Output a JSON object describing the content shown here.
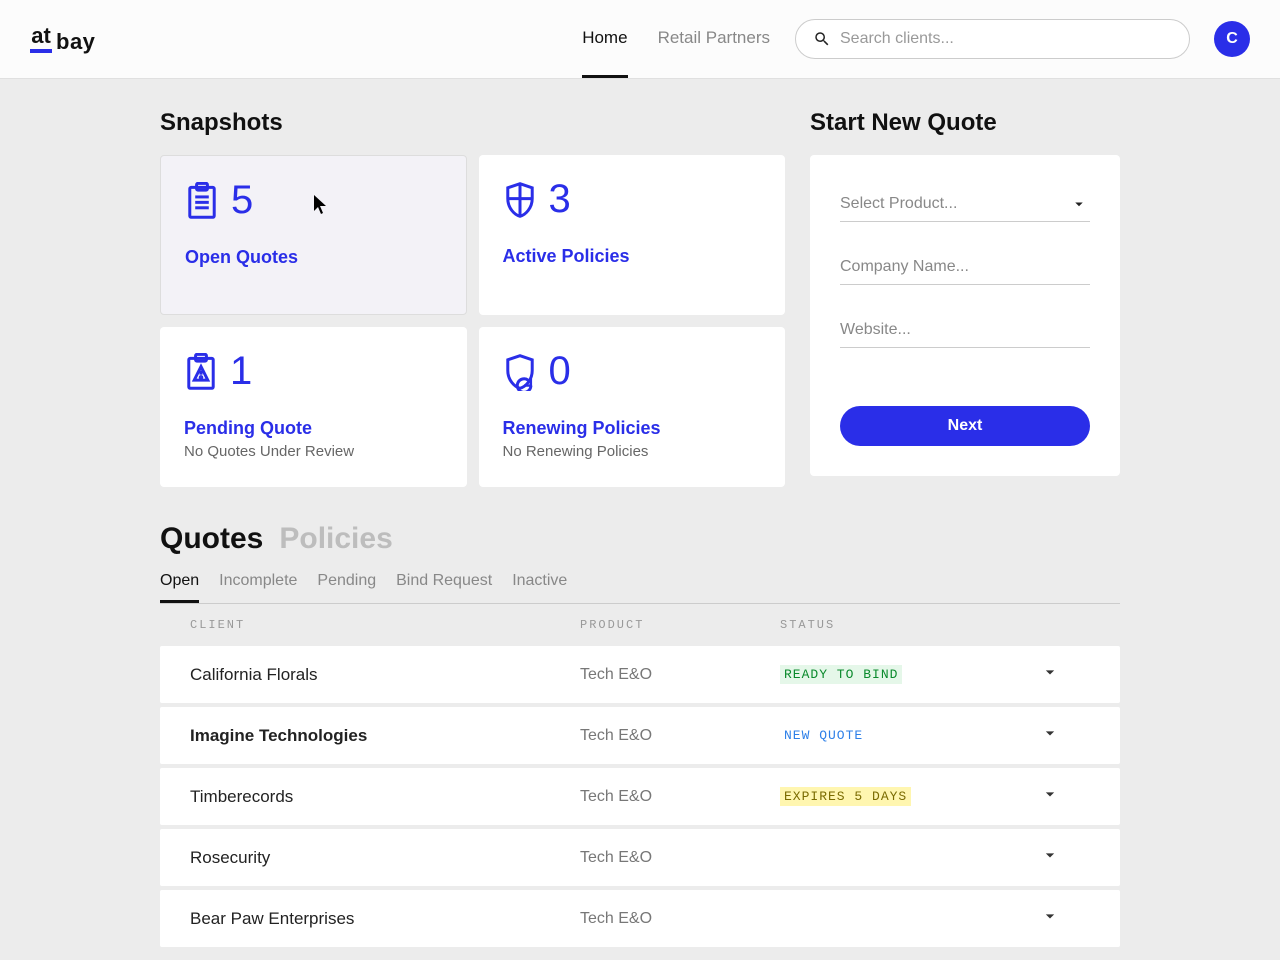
{
  "header": {
    "logo_at": "at",
    "logo_bay": "bay",
    "nav": [
      {
        "label": "Home",
        "active": true
      },
      {
        "label": "Retail Partners",
        "active": false
      }
    ],
    "search_placeholder": "Search clients...",
    "avatar_initial": "C"
  },
  "snapshots": {
    "title": "Snapshots",
    "cards": [
      {
        "count": "5",
        "label": "Open Quotes",
        "sub": "",
        "icon": "clipboard"
      },
      {
        "count": "3",
        "label": "Active Policies",
        "sub": "",
        "icon": "shield"
      },
      {
        "count": "1",
        "label": "Pending Quote",
        "sub": "No Quotes Under Review",
        "icon": "clipboard-alert"
      },
      {
        "count": "0",
        "label": "Renewing Policies",
        "sub": "No Renewing Policies",
        "icon": "shield-refresh"
      }
    ]
  },
  "new_quote": {
    "title": "Start New Quote",
    "product_placeholder": "Select Product...",
    "company_placeholder": "Company Name...",
    "website_placeholder": "Website...",
    "next_label": "Next"
  },
  "list": {
    "major_tabs": [
      {
        "label": "Quotes",
        "active": true
      },
      {
        "label": "Policies",
        "active": false
      }
    ],
    "minor_tabs": [
      {
        "label": "Open",
        "active": true
      },
      {
        "label": "Incomplete",
        "active": false
      },
      {
        "label": "Pending",
        "active": false
      },
      {
        "label": "Bind Request",
        "active": false
      },
      {
        "label": "Inactive",
        "active": false
      }
    ],
    "columns": {
      "client": "CLIENT",
      "product": "PRODUCT",
      "status": "STATUS"
    },
    "rows": [
      {
        "client": "California Florals",
        "product": "Tech E&O",
        "status": "READY TO BIND",
        "status_color": "green",
        "bold": false
      },
      {
        "client": "Imagine Technologies",
        "product": "Tech E&O",
        "status": "NEW QUOTE",
        "status_color": "blue",
        "bold": true
      },
      {
        "client": "Timberecords",
        "product": "Tech E&O",
        "status": "EXPIRES 5 DAYS",
        "status_color": "yellow",
        "bold": false
      },
      {
        "client": "Rosecurity",
        "product": "Tech E&O",
        "status": "",
        "status_color": "",
        "bold": false
      },
      {
        "client": "Bear Paw Enterprises",
        "product": "Tech E&O",
        "status": "",
        "status_color": "",
        "bold": false
      }
    ]
  }
}
